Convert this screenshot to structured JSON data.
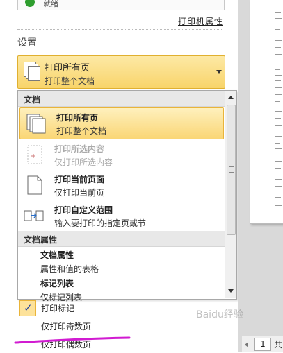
{
  "printer": {
    "status": "就绪",
    "properties_link": "打印机属性"
  },
  "settings": {
    "heading": "设置",
    "selected": {
      "title": "打印所有页",
      "subtitle": "打印整个文档"
    }
  },
  "dropdown": {
    "group_document": "文档",
    "items": [
      {
        "title": "打印所有页",
        "subtitle": "打印整个文档"
      },
      {
        "title": "打印所选内容",
        "subtitle": "仅打印所选内容"
      },
      {
        "title": "打印当前页面",
        "subtitle": "仅打印当前页"
      },
      {
        "title": "打印自定义范围",
        "subtitle": "输入要打印的指定页或节"
      }
    ],
    "group_properties": "文档属性",
    "property_items": [
      {
        "title": "文档属性",
        "subtitle": "属性和值的表格"
      },
      {
        "title": "标记列表",
        "subtitle": "仅标记列表"
      }
    ],
    "checkbox_label": "打印标记",
    "odd_pages": "仅打印奇数页",
    "even_pages": "仅打印偶数页"
  },
  "pager": {
    "page": "1",
    "tail": "共"
  },
  "watermark": "Baidu经验",
  "colors": {
    "highlight": "#fad675",
    "border_accent": "#e9b43a",
    "annotation": "#d11bd1"
  }
}
